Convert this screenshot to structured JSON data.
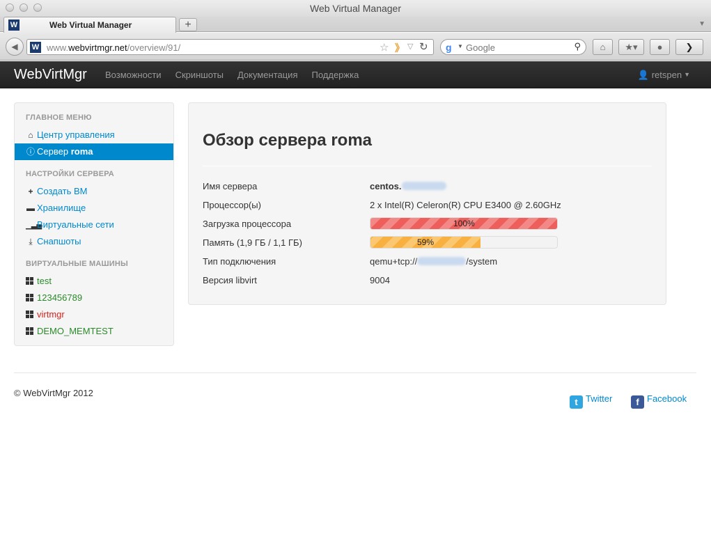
{
  "browser": {
    "window_title": "Web Virtual Manager",
    "tab_label": "Web Virtual Manager",
    "tab_favicon": "W",
    "url_plain": "www.",
    "url_host": "webvirtmgr.net",
    "url_path": "/overview/91/",
    "search_placeholder": "Google",
    "new_tab": "+"
  },
  "topnav": {
    "brand": "WebVirtMgr",
    "links": [
      "Возможности",
      "Скриншоты",
      "Документация",
      "Поддержка"
    ],
    "user": "retspen"
  },
  "sidebar": {
    "header_main": "ГЛАВНОЕ МЕНЮ",
    "dashboard": "Центр управления",
    "server_prefix": "Сервер ",
    "server_name": "roma",
    "header_settings": "НАСТРОЙКИ СЕРВЕРА",
    "create_vm": "Создать ВМ",
    "storage": "Хранилище",
    "networks": "Виртуальные сети",
    "snapshots": "Снапшоты",
    "header_vms": "ВИРТУАЛЬНЫЕ МАШИНЫ",
    "vms": [
      {
        "name": "test",
        "status_color": "#2a8a2a"
      },
      {
        "name": "123456789",
        "status_color": "#2a8a2a"
      },
      {
        "name": "virtmgr",
        "status_color": "#d9231c"
      },
      {
        "name": "DEMO_MEMTEST",
        "status_color": "#2a8a2a"
      }
    ]
  },
  "overview": {
    "title": "Обзор сервера roma",
    "rows": {
      "hostname_label": "Имя сервера",
      "hostname_value": "centos.",
      "cpu_label": "Процессор(ы)",
      "cpu_value": "2 x Intel(R) Celeron(R) CPU E3400 @ 2.60GHz",
      "cpu_load_label": "Загрузка процессора",
      "cpu_load_percent": 100,
      "cpu_load_text": "100%",
      "mem_label": "Память (1,9 ГБ / 1,1 ГБ)",
      "mem_percent": 59,
      "mem_text": "59%",
      "conn_label": "Тип подключения",
      "conn_prefix": "qemu+tcp://",
      "conn_suffix": "/system",
      "libvirt_label": "Версия libvirt",
      "libvirt_value": "9004"
    }
  },
  "footer": {
    "copyright": "© WebVirtMgr 2012",
    "twitter": "Twitter",
    "facebook": "Facebook"
  },
  "colors": {
    "accent": "#0088cc",
    "vm_running": "#2a8a2a",
    "vm_stopped": "#d9231c",
    "cpu_bar": "#ee5f5b",
    "mem_bar": "#f8b040"
  }
}
